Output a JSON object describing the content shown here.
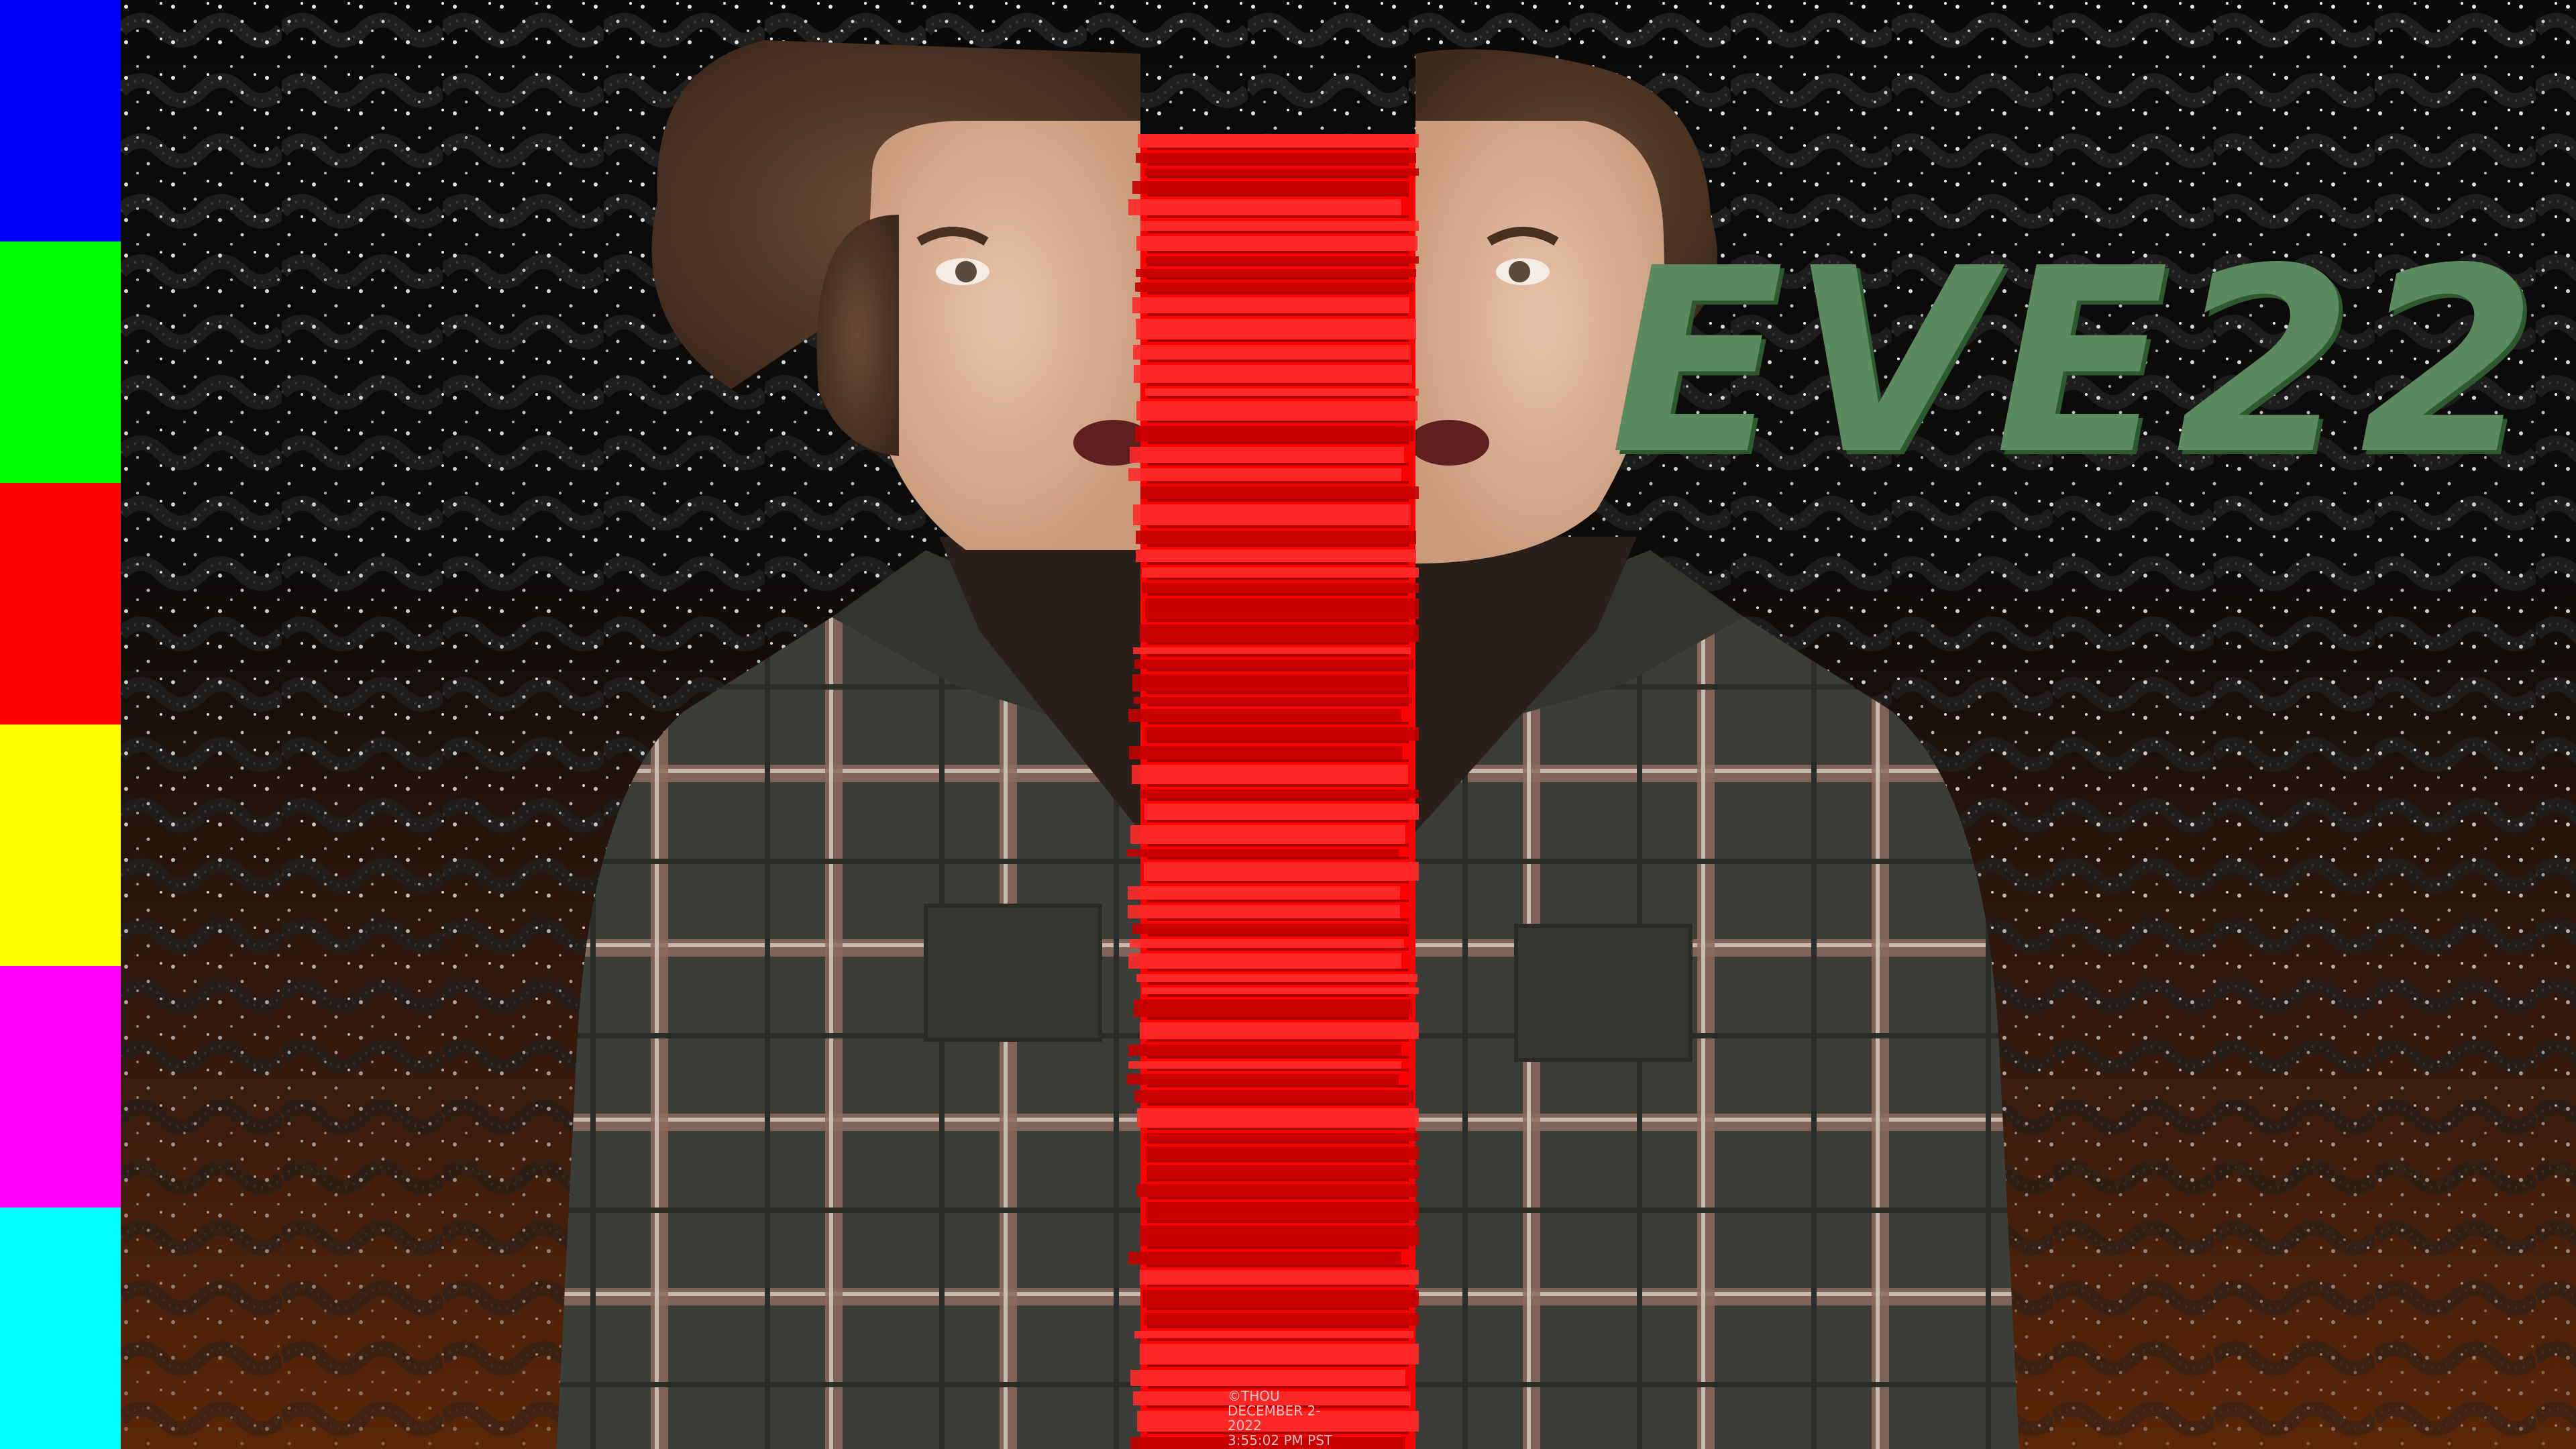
{
  "logo": {
    "text": "EVE22",
    "color": "#5a8a5e",
    "shadow_color": "#2e5a30"
  },
  "watermark": {
    "line1": "©THOU",
    "line2": "DECEMBER 2-",
    "line3": "2022",
    "line4": "3:55:02 PM PST"
  },
  "background": {
    "pattern_text": "EVE22",
    "top_color": "#090909",
    "bottom_color": "#5a2608"
  },
  "color_bars": [
    "#0000ff",
    "#00ff00",
    "#ff0000",
    "#ffff00",
    "#ff00ff",
    "#00ffff"
  ],
  "stripe_color": "#ff0000"
}
